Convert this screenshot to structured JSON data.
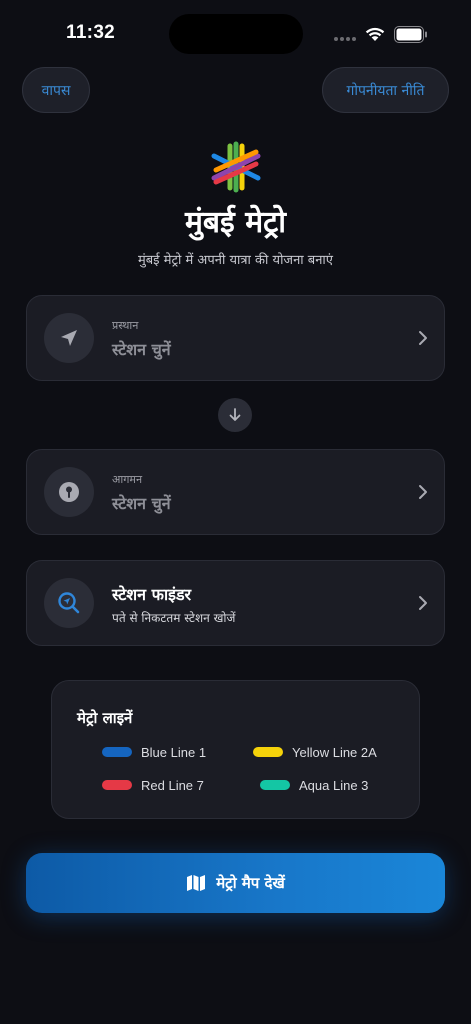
{
  "status_bar": {
    "time": "11:32"
  },
  "header": {
    "back_label": "वापस",
    "privacy_label": "गोपनीयता नीति"
  },
  "app": {
    "title": "मुंबई मेट्रो",
    "subtitle": "मुंबई मेट्रो में अपनी यात्रा की योजना बनाएं"
  },
  "from": {
    "label": "प्रस्थान",
    "placeholder": "स्टेशन चुनें"
  },
  "to": {
    "label": "आगमन",
    "placeholder": "स्टेशन चुनें"
  },
  "finder": {
    "title": "स्टेशन फाइंडर",
    "description": "पते से निकटतम स्टेशन खोजें"
  },
  "metro_lines": {
    "title": "मेट्रो लाइनें",
    "items": [
      {
        "name": "Blue Line 1",
        "color": "#1565c0"
      },
      {
        "name": "Yellow Line 2A",
        "color": "#f5d20a"
      },
      {
        "name": "Red Line 7",
        "color": "#e53946"
      },
      {
        "name": "Aqua Line 3",
        "color": "#14c6a4"
      }
    ]
  },
  "map_button": {
    "label": "मेट्रो मैप देखें"
  },
  "colors": {
    "accent": "#3a8bd6",
    "background": "#0d0e14",
    "card": "#1b1c24"
  },
  "icons": {
    "from": "navigation-arrow-icon",
    "to": "location-pin-icon",
    "finder": "search-location-icon",
    "swap": "arrow-down-icon",
    "map": "map-icon"
  }
}
